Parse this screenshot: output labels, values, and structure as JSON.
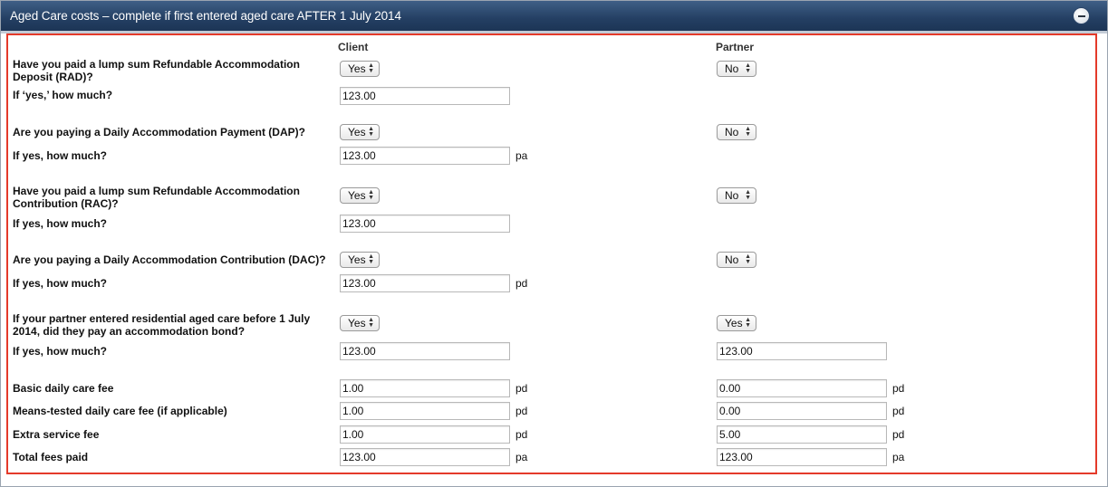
{
  "header": {
    "title": "Aged Care costs – complete if first entered aged care AFTER 1 July 2014",
    "collapse_icon": "minus-circle-icon"
  },
  "columns": {
    "client": "Client",
    "partner": "Partner"
  },
  "labels": {
    "rad_q1": "Have you paid a lump sum Refundable Accommodation",
    "rad_q2": "Deposit (RAD)?",
    "rad_amount": "If ‘yes,’ how much?",
    "dap_q": "Are you paying a Daily Accommodation Payment (DAP)?",
    "dap_amount": "If yes, how much?",
    "rac_q1": "Have you paid a lump sum Refundable Accommodation",
    "rac_q2": "Contribution (RAC)?",
    "rac_amount": "If yes, how much?",
    "dac_q": "Are you paying a Daily Accommodation Contribution (DAC)?",
    "dac_amount": "If yes, how much?",
    "bond_q1": "If your partner entered residential aged care before 1 July",
    "bond_q2": "2014, did they pay an accommodation bond?",
    "bond_amount": "If yes, how much?",
    "basic_fee": "Basic daily care fee",
    "means_fee": "Means-tested daily care fee (if applicable)",
    "extra_fee": "Extra service fee",
    "total_fee": "Total fees paid"
  },
  "client": {
    "rad_select": "Yes",
    "rad_value": "123.00",
    "dap_select": "Yes",
    "dap_value": "123.00",
    "dap_unit": "pa",
    "rac_select": "Yes",
    "rac_value": "123.00",
    "dac_select": "Yes",
    "dac_value": "123.00",
    "dac_unit": "pd",
    "bond_select": "Yes",
    "bond_value": "123.00",
    "basic_value": "1.00",
    "basic_unit": "pd",
    "means_value": "1.00",
    "means_unit": "pd",
    "extra_value": "1.00",
    "extra_unit": "pd",
    "total_value": "123.00",
    "total_unit": "pa"
  },
  "partner": {
    "rad_select": "No",
    "dap_select": "No",
    "rac_select": "No",
    "dac_select": "No",
    "bond_select": "Yes",
    "bond_value": "123.00",
    "basic_value": "0.00",
    "basic_unit": "pd",
    "means_value": "0.00",
    "means_unit": "pd",
    "extra_value": "5.00",
    "extra_unit": "pd",
    "total_value": "123.00",
    "total_unit": "pa"
  }
}
